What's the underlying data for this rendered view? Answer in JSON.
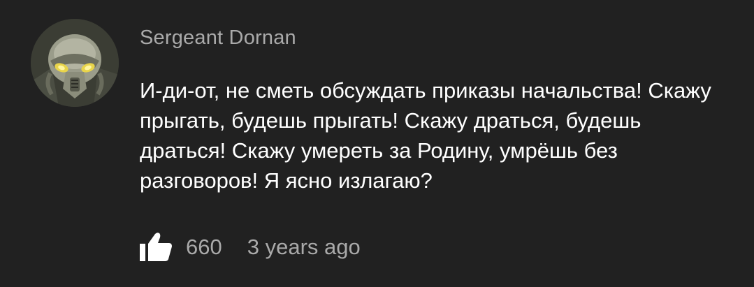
{
  "comment": {
    "author": "Sergeant Dornan",
    "text": "И-ди-от, не сметь обсуждать приказы начальства! Скажу прыгать, будешь прыгать! Скажу драться, будешь драться! Скажу умереть за Родину, умрёшь без разговоров! Я ясно излагаю?",
    "likes": "660",
    "time": "3 years ago",
    "avatar_icon": "power-armor-helmet-icon",
    "like_icon": "thumbs-up-icon"
  },
  "colors": {
    "background": "#212121",
    "text": "#ffffff",
    "secondary_text": "#aaaaaa"
  }
}
